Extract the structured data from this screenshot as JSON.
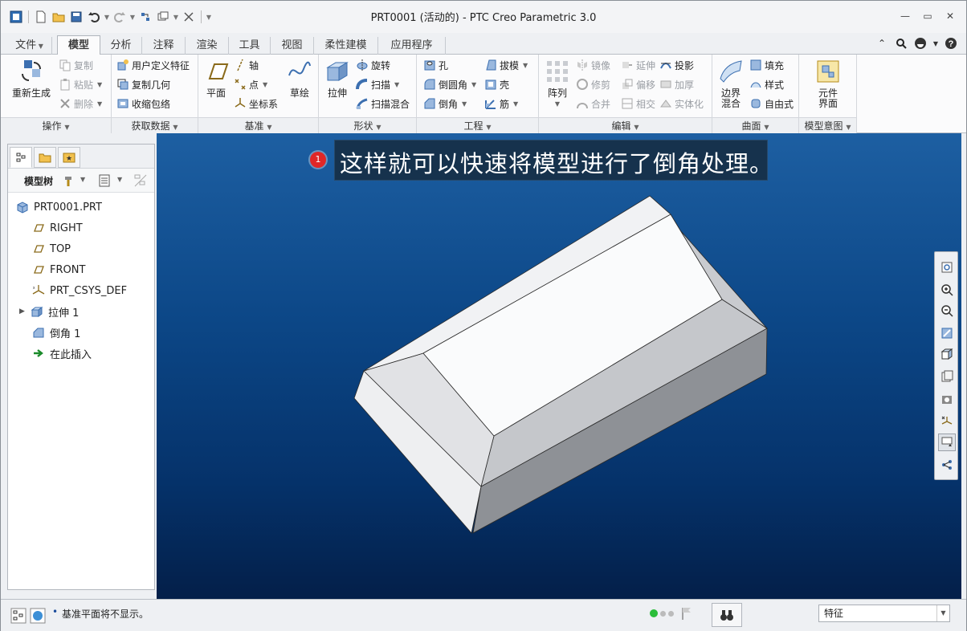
{
  "window": {
    "title": "PRT0001 (活动的) - PTC Creo Parametric 3.0"
  },
  "ribbon_tabs": [
    "文件",
    "模型",
    "分析",
    "注释",
    "渲染",
    "工具",
    "视图",
    "柔性建模",
    "应用程序"
  ],
  "groups": {
    "operations": {
      "label": "操作",
      "regen": "重新生成",
      "copy": "复制",
      "paste": "粘贴",
      "delete": "删除"
    },
    "getdata": {
      "label": "获取数据",
      "udf": "用户定义特征",
      "copygeom": "复制几何",
      "shrinkwrap": "收缩包络"
    },
    "datum": {
      "label": "基准",
      "plane": "平面",
      "axis": "轴",
      "point": "点",
      "csys": "坐标系",
      "sketch": "草绘"
    },
    "shapes": {
      "label": "形状",
      "extrude": "拉伸",
      "revolve": "旋转",
      "sweep": "扫描",
      "sweptblend": "扫描混合"
    },
    "engineering": {
      "label": "工程",
      "hole": "孔",
      "round": "倒圆角",
      "chamfer": "倒角",
      "draft": "拔模",
      "shell": "壳",
      "rib": "筋"
    },
    "pattern": {
      "label": "阵列"
    },
    "editing": {
      "label": "编辑",
      "mirror": "镜像",
      "extend": "延伸",
      "project": "投影",
      "trim": "修剪",
      "offset": "偏移",
      "thicken": "加厚",
      "merge": "合并",
      "intersect": "相交",
      "solidify": "实体化"
    },
    "surfaces": {
      "label": "曲面",
      "boundary": "边界混合",
      "fill": "填充",
      "style": "样式",
      "freestyle": "自由式"
    },
    "intent": {
      "label": "模型意图",
      "component": "元件界面"
    }
  },
  "model_tree": {
    "header": "模型树",
    "items": [
      {
        "label": "PRT0001.PRT",
        "icon": "part-icon"
      },
      {
        "label": "RIGHT",
        "icon": "datum-plane-icon"
      },
      {
        "label": "TOP",
        "icon": "datum-plane-icon"
      },
      {
        "label": "FRONT",
        "icon": "datum-plane-icon"
      },
      {
        "label": "PRT_CSYS_DEF",
        "icon": "csys-icon"
      },
      {
        "label": "拉伸 1",
        "icon": "extrude-icon"
      },
      {
        "label": "倒角 1",
        "icon": "chamfer-icon"
      },
      {
        "label": "在此插入",
        "icon": "insert-arrow-icon"
      }
    ]
  },
  "callout": {
    "number": "1",
    "text": "这样就可以快速将模型进行了倒角处理。"
  },
  "status": {
    "message": "基准平面将不显示。",
    "filter": "特征"
  },
  "colors": {
    "viewport_top": "#1d5fa2",
    "viewport_bottom": "#041f49",
    "badge": "#e02727"
  }
}
